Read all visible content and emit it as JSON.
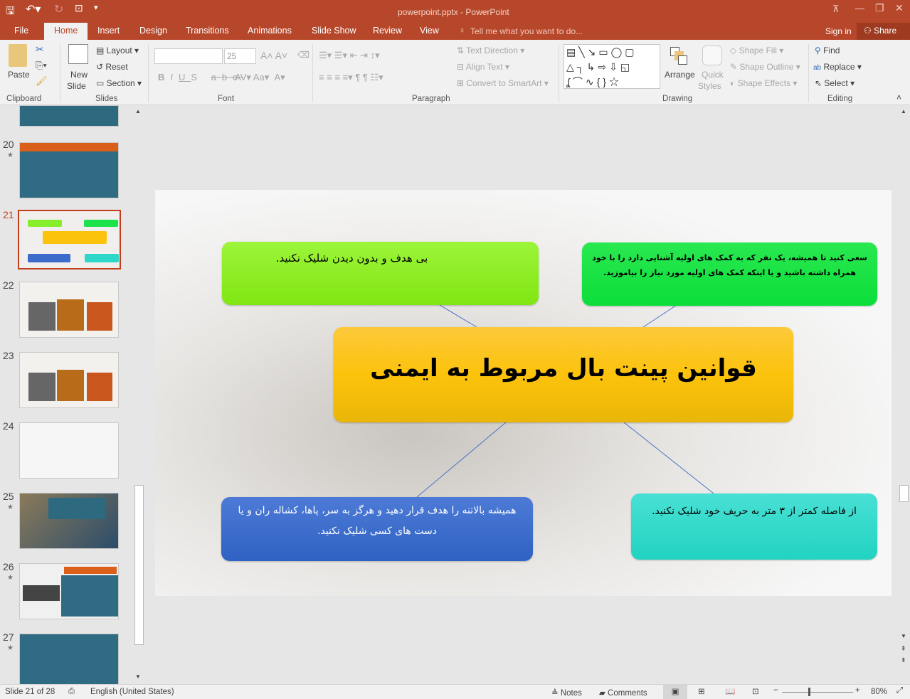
{
  "window": {
    "title": "powerpoint.pptx - PowerPoint"
  },
  "tabs": [
    "File",
    "Home",
    "Insert",
    "Design",
    "Transitions",
    "Animations",
    "Slide Show",
    "Review",
    "View"
  ],
  "tell_me": "Tell me what you want to do...",
  "sign_in": "Sign in",
  "share": "Share",
  "ribbon": {
    "clipboard": {
      "paste": "Paste",
      "label": "Clipboard"
    },
    "slides": {
      "new_slide": "New",
      "new_slide2": "Slide",
      "layout": "Layout",
      "reset": "Reset",
      "section": "Section",
      "label": "Slides"
    },
    "font": {
      "size": "25",
      "label": "Font"
    },
    "paragraph": {
      "text_direction": "Text Direction",
      "align_text": "Align Text",
      "convert": "Convert to SmartArt",
      "label": "Paragraph"
    },
    "drawing": {
      "arrange": "Arrange",
      "quick": "Quick",
      "styles": "Styles",
      "fill": "Shape Fill",
      "outline": "Shape Outline",
      "effects": "Shape Effects",
      "label": "Drawing"
    },
    "editing": {
      "find": "Find",
      "replace": "Replace",
      "select": "Select",
      "label": "Editing"
    }
  },
  "thumbnails": [
    {
      "num": "20",
      "star": true,
      "theme": "teal"
    },
    {
      "num": "21",
      "star": false,
      "theme": "current"
    },
    {
      "num": "22",
      "star": false,
      "theme": "photo"
    },
    {
      "num": "23",
      "star": false,
      "theme": "photo"
    },
    {
      "num": "24",
      "star": false,
      "theme": "text"
    },
    {
      "num": "25",
      "star": true,
      "theme": "soldier"
    },
    {
      "num": "26",
      "star": true,
      "theme": "teal"
    },
    {
      "num": "27",
      "star": true,
      "theme": "teal"
    }
  ],
  "slide": {
    "title": "قوانین پینت بال مربوط به ایمنی",
    "top_left": "بی هدف و بدون دیدن شلیک نکنید.",
    "top_right": "سعی کنید تا همیشه، یک نفر که به کمک های اولیه آشنایی دارد را با خود همراه داشته باشید و یا اینکه کمک های اولیه مورد نیاز را بیاموزید.",
    "bottom_left": "همیشه بالاتنه را هدف قرار دهید و هرگز به سر، پاها، کشاله ران و یا دست های کسی شلیک نکنید.",
    "bottom_right": "از فاصله کمتر از ۳ متر به حریف خود شلیک نکنید."
  },
  "status": {
    "slide": "Slide 21 of 28",
    "language": "English (United States)",
    "notes": "Notes",
    "comments": "Comments",
    "zoom": "80%"
  },
  "colors": {
    "accent": "#b7472a",
    "green": "#8ef22a",
    "green2": "#16e040",
    "orange": "#fcc30c",
    "blue": "#3d6bcc",
    "teal": "#2ed8c8"
  }
}
